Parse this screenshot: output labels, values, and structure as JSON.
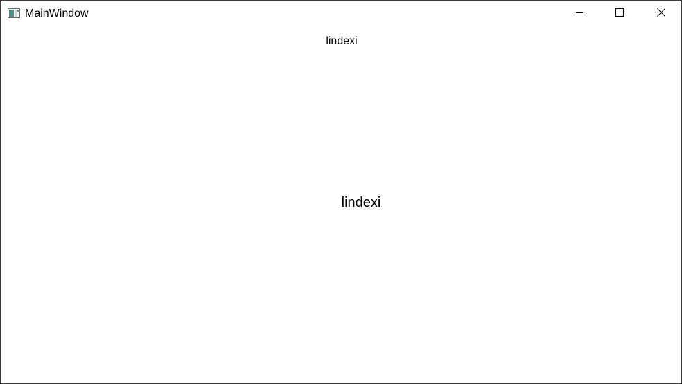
{
  "window": {
    "title": "MainWindow",
    "icon": "app-window-icon",
    "controls": {
      "minimize_icon": "minimize-icon",
      "maximize_icon": "maximize-icon",
      "close_icon": "close-icon"
    }
  },
  "content": {
    "small_text": "lindexi",
    "large_text": "lindexi"
  },
  "colors": {
    "background": "#ffffff",
    "text": "#000000",
    "border": "#3c3c3c"
  }
}
